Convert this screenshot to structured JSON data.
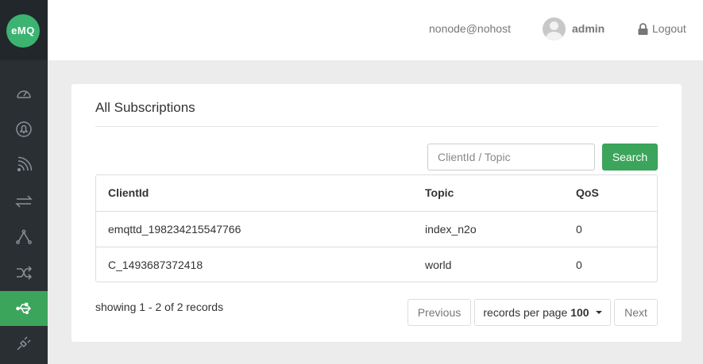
{
  "app": {
    "logo_text": "eMQ",
    "brand_color": "#3ca55c"
  },
  "sidebar": {
    "items": [
      {
        "icon": "dashboard-gauge-icon",
        "active": false
      },
      {
        "icon": "bell-circle-icon",
        "active": false
      },
      {
        "icon": "rss-icon",
        "active": false
      },
      {
        "icon": "exchange-arrows-icon",
        "active": false
      },
      {
        "icon": "share-nodes-icon",
        "active": false
      },
      {
        "icon": "shuffle-icon",
        "active": false
      },
      {
        "icon": "usb-icon",
        "active": true
      },
      {
        "icon": "plug-icon",
        "active": false
      }
    ]
  },
  "header": {
    "node": "nonode@nohost",
    "username": "admin",
    "logout_label": "Logout"
  },
  "card": {
    "title": "All Subscriptions",
    "search": {
      "placeholder": "ClientId / Topic",
      "value": "",
      "button_label": "Search"
    },
    "table": {
      "columns": [
        "ClientId",
        "Topic",
        "QoS"
      ],
      "rows": [
        [
          "emqttd_198234215547766",
          "index_n2o",
          "0"
        ],
        [
          "C_1493687372418",
          "world",
          "0"
        ]
      ]
    },
    "footer": {
      "showing": "showing 1 - 2 of 2 records",
      "prev_label": "Previous",
      "per_page_label": "records per page",
      "per_page_value": "100",
      "next_label": "Next"
    }
  }
}
